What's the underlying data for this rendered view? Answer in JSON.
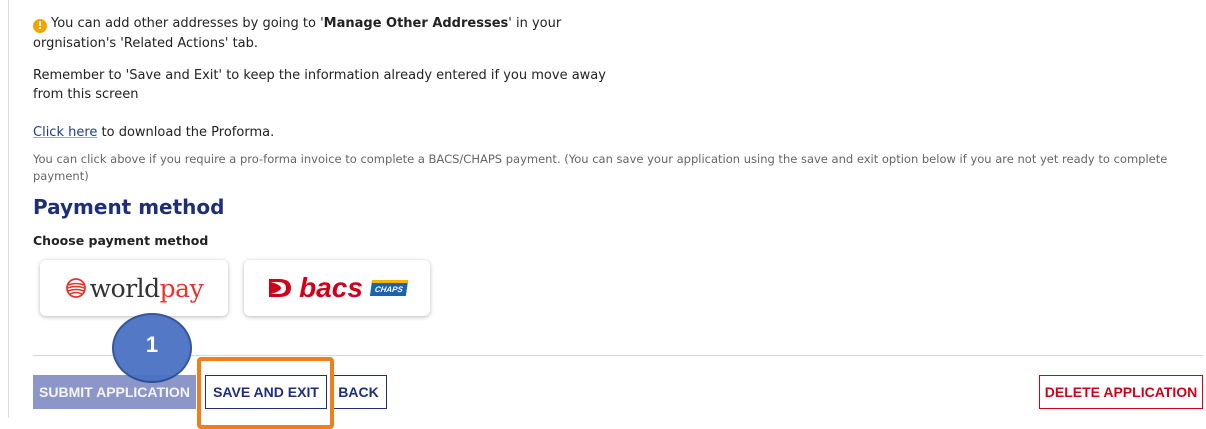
{
  "info": {
    "addresses_prefix": "You can add other addresses by going to '",
    "addresses_bold": "Manage Other Addresses",
    "addresses_suffix": "' in your",
    "addresses_line2": "orgnisation's 'Related Actions' tab.",
    "save_reminder_line1": "Remember to 'Save and Exit' to keep the information already entered if you move away",
    "save_reminder_line2": "from this screen",
    "proforma_link": "Click here",
    "proforma_text": " to download the Proforma.",
    "proforma_hint": "You can click above if you require a pro-forma invoice to complete a BACS/CHAPS payment. (You can save your application using the save and exit option below if you are not yet ready to complete payment)"
  },
  "payment": {
    "title": "Payment method",
    "choose_label": "Choose payment method",
    "worldpay": {
      "logo_prefix": "world",
      "logo_suffix": "pay"
    },
    "bacs": {
      "logo_text": "bacs",
      "badge": "CHAPS"
    }
  },
  "actions": {
    "submit_label": "SUBMIT APPLICATION",
    "save_exit_label": "SAVE AND EXIT",
    "back_label": "BACK",
    "delete_label": "DELETE APPLICATION"
  },
  "annotation": {
    "step_number": "1"
  },
  "colors": {
    "brand_navy": "#1e2f7a",
    "disabled_submit": "#8c96c8",
    "danger_red": "#d0021b",
    "highlight_orange": "#f07f1b",
    "marker_blue": "#4a72c4",
    "warning_amber": "#f2a500"
  },
  "icons": {
    "info": "exclamation-circle-icon",
    "worldpay": "worldpay-globe-icon",
    "bacs": "bacs-swoosh-icon"
  }
}
